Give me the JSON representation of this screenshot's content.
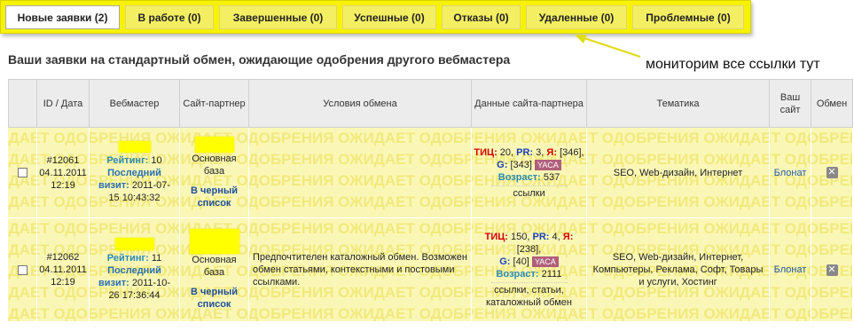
{
  "tabs": [
    {
      "label": "Новые заявки (2)",
      "active": true
    },
    {
      "label": "В работе (0)",
      "active": false
    },
    {
      "label": "Завершенные (0)",
      "active": false
    },
    {
      "label": "Успешные (0)",
      "active": false
    },
    {
      "label": "Отказы (0)",
      "active": false
    },
    {
      "label": "Удаленные (0)",
      "active": false
    },
    {
      "label": "Проблемные (0)",
      "active": false
    }
  ],
  "annotation": {
    "note": "мониторим все ссылки тут"
  },
  "heading": "Ваши заявки на стандартный обмен, ожидающие одобрения другого вебмастера",
  "table": {
    "headers": {
      "id_date": "ID / Дата",
      "webmaster": "Вебмастер",
      "partner_site": "Сайт-партнер",
      "terms": "Условия обмена",
      "partner_data": "Данные сайта-партнера",
      "topic": "Тематика",
      "your_site_1": "Ваш",
      "your_site_2": "сайт",
      "exchange": "Обмен"
    },
    "watermark": "ОЖИДАЕТ ОДОБРЕНИЯ",
    "rows": [
      {
        "id": "#12061",
        "date": "04.11.2011",
        "time": "12:19",
        "rating_label": "Рейтинг:",
        "rating_value": "10",
        "last_visit_label_1": "Последний",
        "last_visit_label_2": "визит:",
        "last_visit_value_1": "2011-07-",
        "last_visit_value_2": "15 10:43:32",
        "base_1": "Основная",
        "base_2": "база",
        "blacklist_1": "В черный",
        "blacklist_2": "список",
        "terms": "",
        "tic_label": "ТИЦ:",
        "tic_value": "20,",
        "pr_label": "PR:",
        "pr_value": "3,",
        "ya_label": "Я:",
        "ya_value": "[346],",
        "g_label": "G:",
        "g_value": "[343]",
        "yaca": "YACA",
        "age_label": "Возраст:",
        "age_value": "537",
        "link_types": "ссылки",
        "topic": "SEO, Web-дизайн, Интернет",
        "your_site": "Блонат"
      },
      {
        "id": "#12062",
        "date": "04.11.2011",
        "time": "12:19",
        "rating_label": "Рейтинг:",
        "rating_value": "11",
        "last_visit_label_1": "Последний",
        "last_visit_label_2": "визит:",
        "last_visit_value_1": "2011-10-",
        "last_visit_value_2": "26 17:36:44",
        "base_1": "Основная",
        "base_2": "база",
        "blacklist_1": "В черный",
        "blacklist_2": "список",
        "terms": "Предпочтителен каталожный обмен. Возможен обмен статьями, контекстными и постовыми ссылками.",
        "tic_label": "ТИЦ:",
        "tic_value": "150,",
        "pr_label": "PR:",
        "pr_value": "4,",
        "ya_label": "Я:",
        "ya_value": "[238],",
        "g_label": "G:",
        "g_value": "[40]",
        "yaca": "YACA",
        "age_label": "Возраст:",
        "age_value": "2111",
        "link_types": "ссылки, статьи, каталожный обмен",
        "topic": "SEO, Web-дизайн, Интернет, Компьютеры, Реклама, Софт, Товары и услуги, Хостинг",
        "your_site": "Блонат"
      }
    ]
  },
  "colors": {
    "tabbar": "#f7f300",
    "row_bg": "#faf7b6",
    "watermark": "#f2e97c",
    "arrow": "#e0dc14"
  }
}
